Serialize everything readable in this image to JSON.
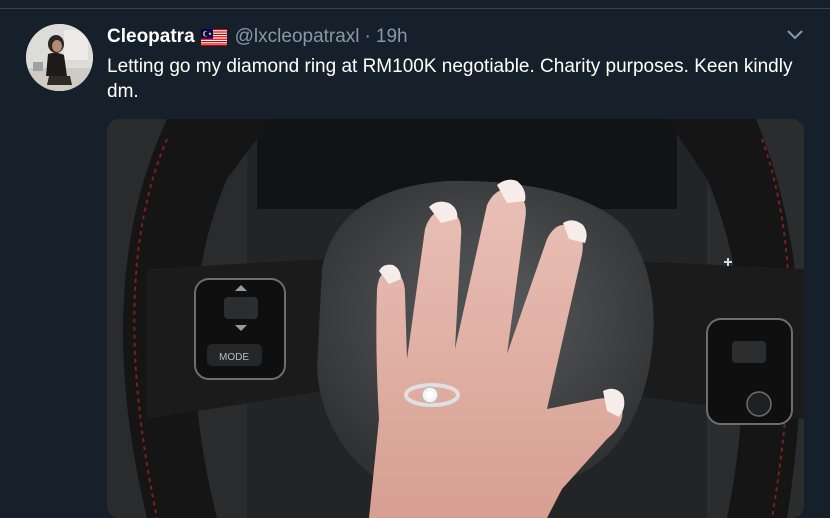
{
  "tweet": {
    "display_name": "Cleopatra",
    "country_flag": "flag-icon-malaysia",
    "handle": "@lxcleopatraxl",
    "separator": "·",
    "timestamp": "19h",
    "text": "Letting go my diamond ring at RM100K negotiable. Charity purposes. Keen kindly dm.",
    "menu_icon": "chevron-down-icon",
    "media": {
      "kind": "photo",
      "visible_text": "MODE"
    }
  },
  "colors": {
    "background": "#15202b",
    "divider": "#38444d",
    "secondary_text": "#8899a6",
    "primary_text": "#ffffff"
  }
}
